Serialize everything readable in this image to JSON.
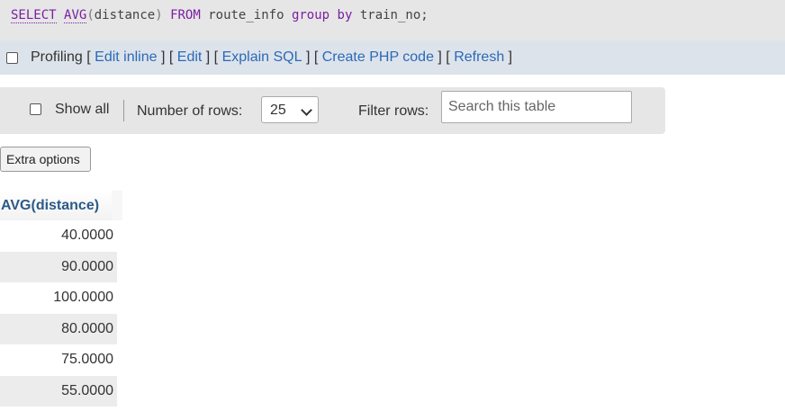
{
  "sql_query": {
    "select": "SELECT",
    "func": "AVG",
    "open_paren": "(",
    "column": "distance",
    "close_paren": ")",
    "from": "FROM",
    "table": "route_info",
    "group": "group",
    "by": "by",
    "group_column": "train_no;"
  },
  "profiling": {
    "label": "Profiling",
    "links": [
      "Edit inline",
      "Edit",
      "Explain SQL",
      "Create PHP code",
      "Refresh"
    ]
  },
  "navigation": {
    "show_all_label": "Show all",
    "rows_label": "Number of rows:",
    "rows_value": "25",
    "filter_label": "Filter rows:",
    "search_placeholder": "Search this table"
  },
  "extra_options_label": "Extra options",
  "results": {
    "column_header": "AVG(distance)",
    "rows": [
      "40.0000",
      "90.0000",
      "100.0000",
      "80.0000",
      "75.0000",
      "55.0000"
    ]
  }
}
